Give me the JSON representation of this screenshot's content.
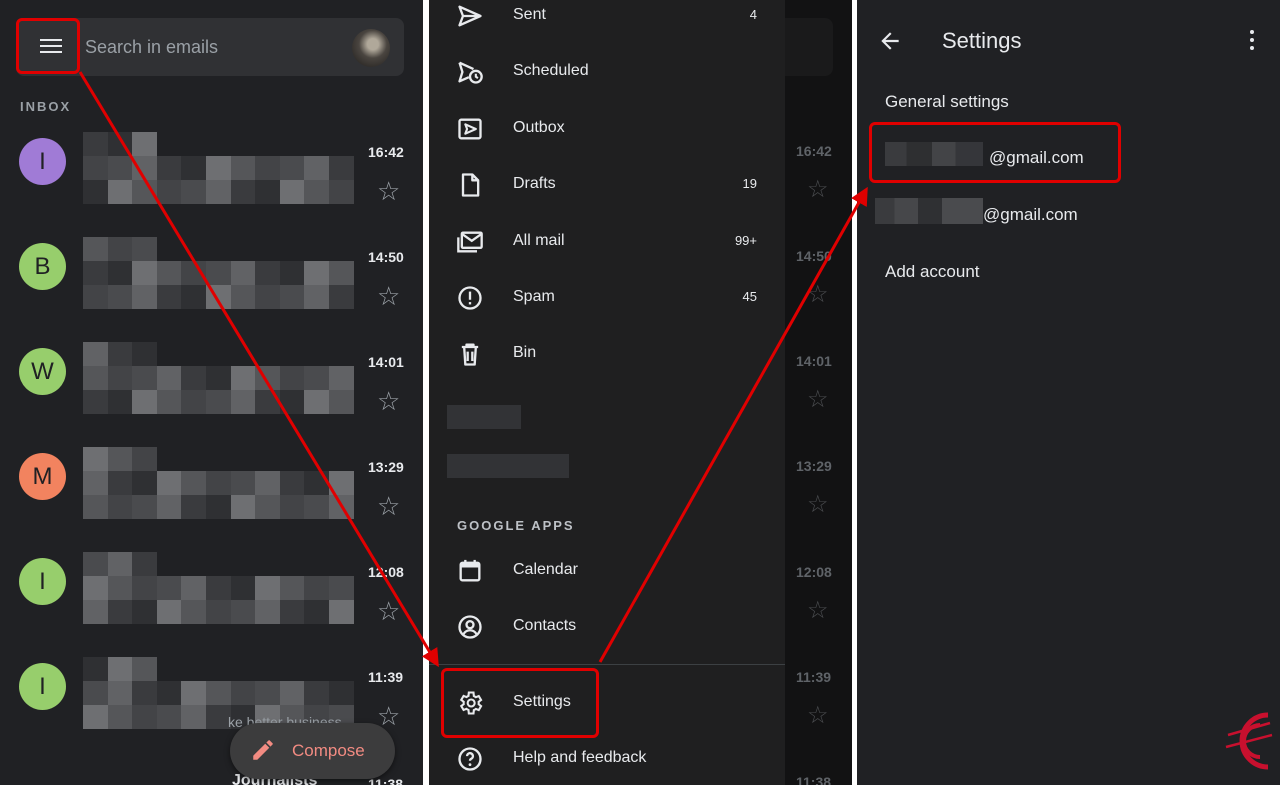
{
  "panel1": {
    "search": {
      "placeholder": "Search in emails"
    },
    "inbox_label": "INBOX",
    "rows": [
      {
        "letter": "I",
        "time": "16:42",
        "color": "#a07bd6"
      },
      {
        "letter": "B",
        "time": "14:50",
        "color": "#97ce6c"
      },
      {
        "letter": "W",
        "time": "14:01",
        "color": "#97ce6c"
      },
      {
        "letter": "M",
        "time": "13:29",
        "color": "#f2835f"
      },
      {
        "letter": "I",
        "time": "12:08",
        "color": "#97ce6c"
      },
      {
        "letter": "I",
        "time": "11:39",
        "color": "#97ce6c"
      }
    ],
    "partial_row_time": "11:38",
    "bg_snippet": "ke better business",
    "bg_journalists": "Journalists",
    "compose_label": "Compose"
  },
  "panel2": {
    "nav": [
      {
        "icon": "send-icon",
        "label": "Sent",
        "count": "4"
      },
      {
        "icon": "scheduled-icon",
        "label": "Scheduled",
        "count": ""
      },
      {
        "icon": "outbox-icon",
        "label": "Outbox",
        "count": ""
      },
      {
        "icon": "draft-icon",
        "label": "Drafts",
        "count": "19"
      },
      {
        "icon": "all-mail-icon",
        "label": "All mail",
        "count": "99+"
      },
      {
        "icon": "spam-icon",
        "label": "Spam",
        "count": "45"
      },
      {
        "icon": "bin-icon",
        "label": "Bin",
        "count": ""
      }
    ],
    "google_apps_label": "GOOGLE APPS",
    "apps": [
      {
        "icon": "calendar-icon",
        "label": "Calendar"
      },
      {
        "icon": "contacts-icon",
        "label": "Contacts"
      }
    ],
    "settings_label": "Settings",
    "help_label": "Help and feedback",
    "strip_times": [
      "16:42",
      "14:50",
      "14:01",
      "13:29",
      "12:08",
      "11:39",
      "11:38"
    ]
  },
  "panel3": {
    "title": "Settings",
    "general_settings": "General settings",
    "account1_suffix": "@gmail.com",
    "account2_suffix": "@gmail.com",
    "add_account": "Add account"
  },
  "colors": {
    "annotation": "#e00000",
    "compose_text": "#f28b82"
  }
}
